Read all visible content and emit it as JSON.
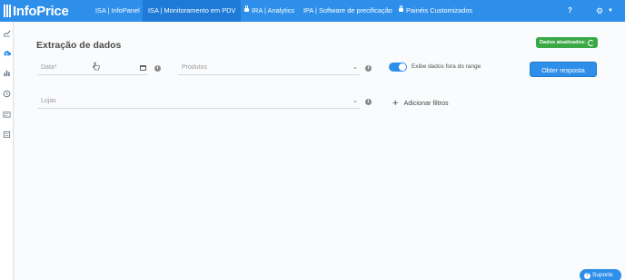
{
  "header": {
    "logo_text": "InfoPrice",
    "nav": [
      {
        "label": "ISA | InfoPanel",
        "locked": false,
        "active": false
      },
      {
        "label": "ISA | Monitoramento em PDV",
        "locked": false,
        "active": true
      },
      {
        "label": "IRA | Analytics",
        "locked": true,
        "active": false
      },
      {
        "label": "IPA | Software de precificação",
        "locked": false,
        "active": false
      },
      {
        "label": "Painéis Customizados",
        "locked": true,
        "active": false
      }
    ],
    "help_label": "?",
    "settings_icon": "gear-icon"
  },
  "sidebar": {
    "icons": [
      "trend-chart-icon",
      "cloud-download-icon",
      "bar-chart-icon",
      "clock-icon",
      "report-icon",
      "document-icon"
    ]
  },
  "main": {
    "title": "Extração de dados",
    "status_badge": "Dados atualizados:",
    "date_placeholder": "Data*",
    "products_placeholder": "Produtos",
    "stores_placeholder": "Lojas",
    "toggle_label": "Exibe dados fora do range",
    "toggle_on": true,
    "submit_label": "Obter resposta",
    "add_filters_label": "Adicionar filtros",
    "info_glyph": "i"
  },
  "support": {
    "label": "Suporte",
    "glyph": "?"
  },
  "colors": {
    "primary": "#2e8fea",
    "success": "#3aa845"
  }
}
